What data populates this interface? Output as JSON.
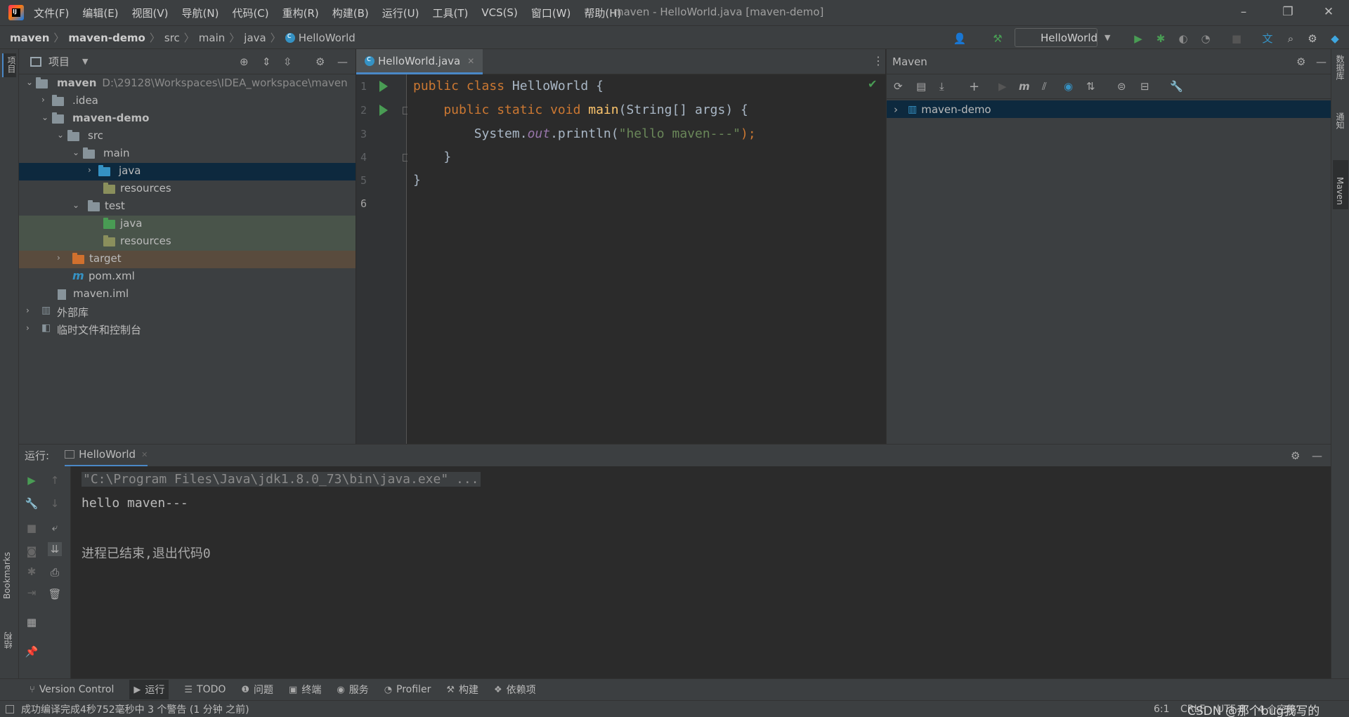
{
  "titlebar": {
    "menu": [
      "文件(F)",
      "编辑(E)",
      "视图(V)",
      "导航(N)",
      "代码(C)",
      "重构(R)",
      "构建(B)",
      "运行(U)",
      "工具(T)",
      "VCS(S)",
      "窗口(W)",
      "帮助(H)"
    ],
    "title": "maven - HelloWorld.java [maven-demo]"
  },
  "breadcrumbs": [
    "maven",
    "maven-demo",
    "src",
    "main",
    "java",
    "HelloWorld"
  ],
  "run_config": "HelloWorld",
  "project_panel": {
    "title": "项目",
    "tree": [
      {
        "label": "maven",
        "path": "D:\\29128\\Workspaces\\IDEA_workspace\\maven",
        "bold": true
      },
      {
        "label": ".idea"
      },
      {
        "label": "maven-demo",
        "bold": true
      },
      {
        "label": "src"
      },
      {
        "label": "main"
      },
      {
        "label": "java"
      },
      {
        "label": "resources"
      },
      {
        "label": "test"
      },
      {
        "label": "java"
      },
      {
        "label": "resources"
      },
      {
        "label": "target"
      },
      {
        "label": "pom.xml"
      },
      {
        "label": "maven.iml"
      },
      {
        "label": "外部库"
      },
      {
        "label": "临时文件和控制台"
      }
    ]
  },
  "editor": {
    "tab": "HelloWorld.java",
    "line_numbers": [
      "1",
      "2",
      "3",
      "4",
      "5",
      "6"
    ],
    "code": {
      "l1_kw": "public class ",
      "l1_name": "HelloWorld",
      "l1_rest": " {",
      "l2_kw": "    public static void ",
      "l2_fn": "main",
      "l2_rest": "(String[] args) {",
      "l3_a": "        System.",
      "l3_field": "out",
      "l3_b": ".println(",
      "l3_str": "\"hello maven---\"",
      "l3_c": ");",
      "l4": "    }",
      "l5": "}"
    }
  },
  "maven": {
    "title": "Maven",
    "project": "maven-demo"
  },
  "run_panel": {
    "label": "运行:",
    "tab": "HelloWorld",
    "output": [
      "\"C:\\Program Files\\Java\\jdk1.8.0_73\\bin\\java.exe\" ...",
      "hello maven---",
      "",
      "进程已结束,退出代码0"
    ]
  },
  "left_strip": {
    "top": "项目",
    "bookmarks": "Bookmarks",
    "structure": "结构"
  },
  "right_strip": {
    "database": "数据库",
    "notifications": "通知",
    "maven": "Maven"
  },
  "tool_tabs": [
    {
      "icon": "vcs-icon",
      "glyph": "⑂",
      "label": "Version Control"
    },
    {
      "icon": "run-icon",
      "glyph": "▶",
      "label": "运行"
    },
    {
      "icon": "todo-icon",
      "glyph": "☰",
      "label": "TODO"
    },
    {
      "icon": "problems-icon",
      "glyph": "❶",
      "label": "问题"
    },
    {
      "icon": "terminal-icon",
      "glyph": "▣",
      "label": "终端"
    },
    {
      "icon": "services-icon",
      "glyph": "◉",
      "label": "服务"
    },
    {
      "icon": "profiler-icon",
      "glyph": "◔",
      "label": "Profiler"
    },
    {
      "icon": "build-icon",
      "glyph": "⚒",
      "label": "构建"
    },
    {
      "icon": "dependencies-icon",
      "glyph": "❖",
      "label": "依赖项"
    }
  ],
  "status": {
    "message": "成功编译完成4秒752毫秒中 3 个警告 (1 分钟 之前)",
    "position": "6:1",
    "line_sep": "CRLF",
    "encoding": "UTF-8",
    "indent": "4 个空格",
    "watermark": "CSDN @那个bug我写的"
  },
  "colors": {
    "keyword": "#cc7832",
    "function": "#ffc66d",
    "string": "#6a8759",
    "field": "#9876aa",
    "run_green": "#499c54",
    "selection": "#0d293e"
  }
}
